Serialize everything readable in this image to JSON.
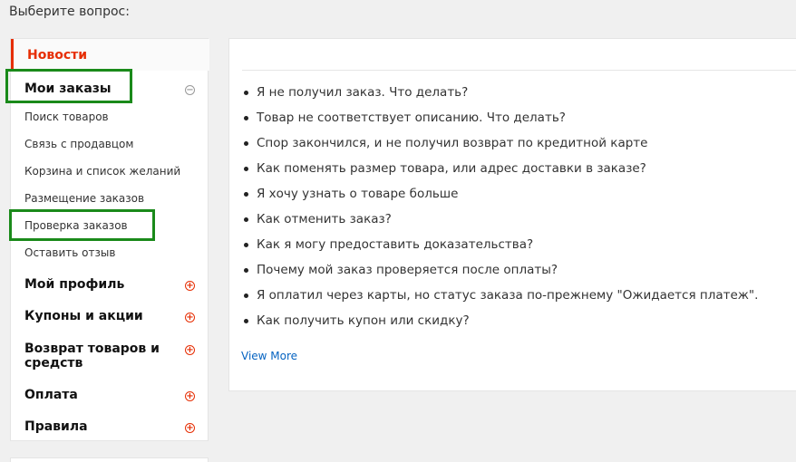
{
  "page": {
    "title": "Выберите вопрос:"
  },
  "sidebar": {
    "news": "Новости",
    "my_orders": "Мои заказы",
    "sub_items": [
      "Поиск товаров",
      "Связь с продавцом",
      "Корзина и список желаний",
      "Размещение заказов",
      "Проверка заказов",
      "Оставить отзыв"
    ],
    "categories": [
      "Мой профиль",
      "Купоны и акции",
      "Возврат товаров и средств",
      "Оплата",
      "Правила"
    ],
    "expand_icon": "+",
    "collapse_icon": "−"
  },
  "main": {
    "questions": [
      "Я не получил заказ. Что делать?",
      "Товар не соответствует описанию. Что делать?",
      "Спор закончился, и не получил возврат по кредитной карте",
      "Как поменять размер товара, или адрес доставки в заказе?",
      "Я хочу узнать о товаре больше",
      "Как отменить заказ?",
      "Как я могу предоставить доказательства?",
      "Почему мой заказ проверяется после оплаты?",
      "Я оплатил через карты, но статус заказа по-прежнему \"Ожидается платеж\".",
      "Как получить купон или скидку?"
    ],
    "view_more": "View More"
  },
  "colors": {
    "accent": "#e62e04",
    "highlight": "#1a8a1a",
    "link": "#0563c1"
  }
}
